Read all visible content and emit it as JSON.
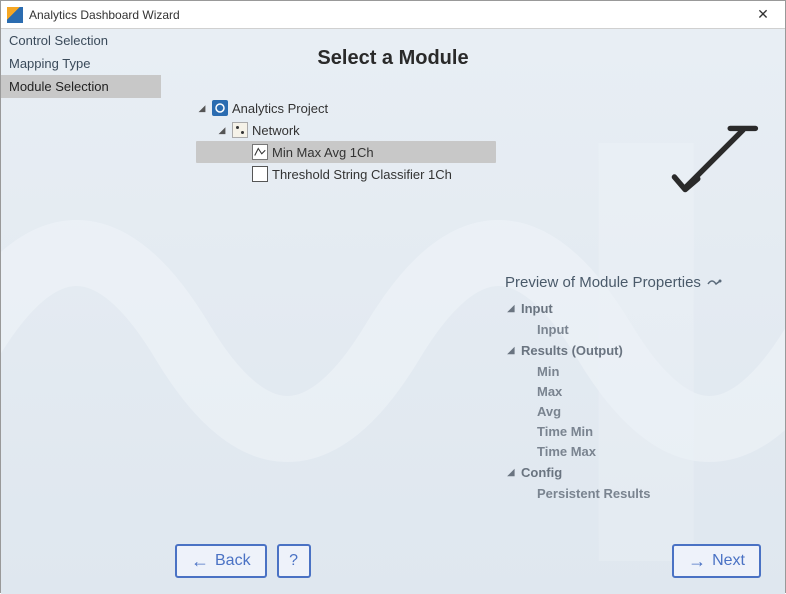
{
  "window": {
    "title": "Analytics Dashboard Wizard"
  },
  "steps": {
    "items": [
      {
        "label": "Control Selection",
        "selected": false
      },
      {
        "label": "Mapping Type",
        "selected": false
      },
      {
        "label": "Module Selection",
        "selected": true
      }
    ]
  },
  "main": {
    "title": "Select a Module"
  },
  "tree": {
    "root": {
      "label": "Analytics Project",
      "children_label": "Network",
      "items": [
        {
          "label": "Min Max Avg 1Ch",
          "selected": true
        },
        {
          "label": "Threshold String Classifier 1Ch",
          "selected": false
        }
      ]
    }
  },
  "preview": {
    "title": "Preview of Module Properties",
    "groups": [
      {
        "label": "Input",
        "children": [
          "Input"
        ]
      },
      {
        "label": "Results (Output)",
        "children": [
          "Min",
          "Max",
          "Avg",
          "Time Min",
          "Time Max"
        ]
      },
      {
        "label": "Config",
        "children": [
          "Persistent Results"
        ]
      }
    ]
  },
  "buttons": {
    "back": "Back",
    "help": "?",
    "next": "Next"
  }
}
